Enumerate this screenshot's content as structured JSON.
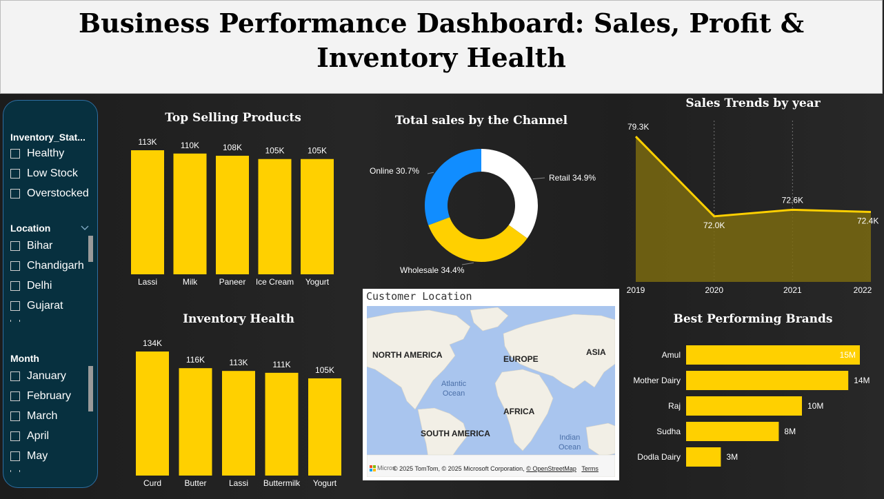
{
  "header": {
    "title": "Business Performance Dashboard: Sales, Profit & Inventory Health"
  },
  "slicers": {
    "inventory": {
      "title": "Inventory_Stat...",
      "options": [
        "Healthy",
        "Low Stock",
        "Overstocked"
      ]
    },
    "location": {
      "title": "Location",
      "options": [
        "Bihar",
        "Chandigarh",
        "Delhi",
        "Gujarat"
      ]
    },
    "month": {
      "title": "Month",
      "options": [
        "January",
        "February",
        "March",
        "April",
        "May"
      ]
    }
  },
  "top_selling": {
    "title": "Top Selling Products"
  },
  "inventory_health": {
    "title": "Inventory Health"
  },
  "channel_sales": {
    "title": "Total sales by the Channel"
  },
  "sales_trends": {
    "title": "Sales Trends by year"
  },
  "best_brands": {
    "title": "Best Performing Brands"
  },
  "map": {
    "title": "Customer Location",
    "labels": {
      "north_america": "NORTH AMERICA",
      "europe": "EUROPE",
      "asia": "ASIA",
      "africa": "AFRICA",
      "south_america": "SOUTH AMERICA",
      "atlantic": "Atlantic\nOcean",
      "indian": "Indian\nOcean"
    },
    "credit": "© 2025 TomTom, © 2025 Microsoft Corporation,",
    "credit_osm": "© OpenStreetMap",
    "credit_terms": "Terms",
    "logo": "Micros"
  },
  "colors": {
    "bar": "#ffd000",
    "online": "#118dff",
    "retail": "#ffffff",
    "wholesale": "#ffd000",
    "area_fill": "#7a6a10",
    "slicer_bg": "#07303f"
  },
  "chart_data": [
    {
      "id": "top_selling",
      "type": "bar",
      "title": "Top Selling Products",
      "categories": [
        "Lassi",
        "Milk",
        "Paneer",
        "Ice Cream",
        "Yogurt"
      ],
      "values": [
        113000,
        110000,
        108000,
        105000,
        105000
      ],
      "labels": [
        "113K",
        "110K",
        "108K",
        "105K",
        "105K"
      ]
    },
    {
      "id": "inventory_health",
      "type": "bar",
      "title": "Inventory Health",
      "categories": [
        "Curd",
        "Butter",
        "Lassi",
        "Buttermilk",
        "Yogurt"
      ],
      "values": [
        134000,
        116000,
        113000,
        111000,
        105000
      ],
      "labels": [
        "134K",
        "116K",
        "113K",
        "111K",
        "105K"
      ]
    },
    {
      "id": "channel_sales",
      "type": "pie",
      "title": "Total sales by the Channel",
      "slices": [
        {
          "name": "Retail",
          "value": 34.9,
          "label": "Retail 34.9%"
        },
        {
          "name": "Wholesale",
          "value": 34.4,
          "label": "Wholesale 34.4%"
        },
        {
          "name": "Online",
          "value": 30.7,
          "label": "Online 30.7%"
        }
      ]
    },
    {
      "id": "sales_trends",
      "type": "area",
      "title": "Sales Trends by year",
      "x": [
        "2019",
        "2020",
        "2021",
        "2022"
      ],
      "values": [
        79300,
        72000,
        72600,
        72400
      ],
      "labels": [
        "79.3K",
        "72.0K",
        "72.6K",
        "72.4K"
      ]
    },
    {
      "id": "best_brands",
      "type": "bar",
      "orientation": "horizontal",
      "title": "Best Performing Brands",
      "categories": [
        "Amul",
        "Mother Dairy",
        "Raj",
        "Sudha",
        "Dodla Dairy"
      ],
      "values": [
        15000000,
        14000000,
        10000000,
        8000000,
        3000000
      ],
      "labels": [
        "15M",
        "14M",
        "10M",
        "8M",
        "3M"
      ]
    }
  ]
}
